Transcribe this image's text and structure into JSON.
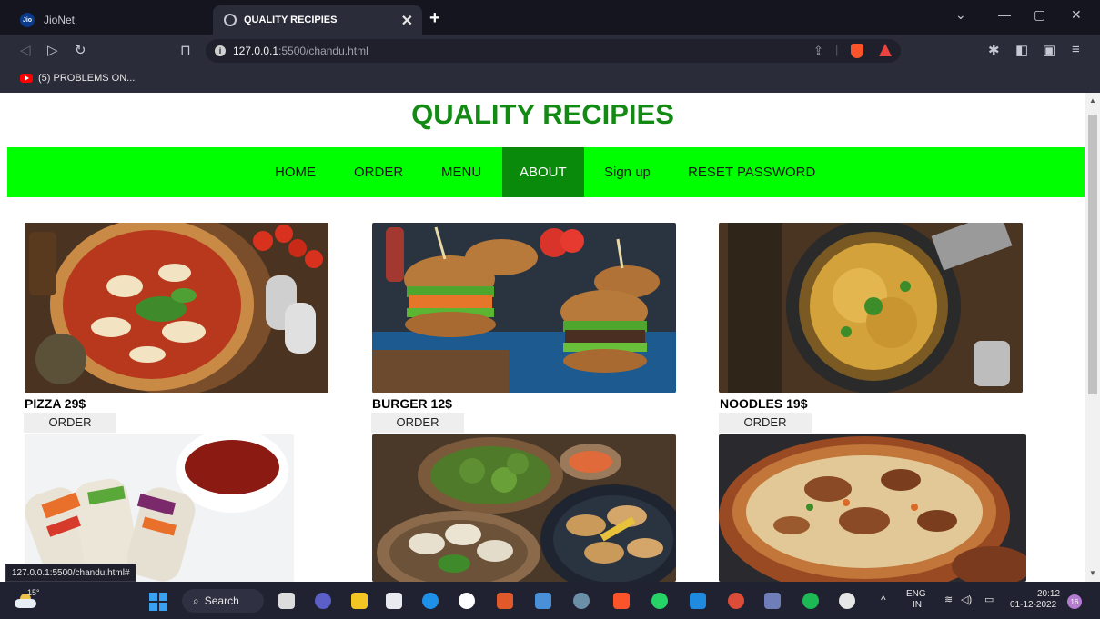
{
  "browser": {
    "tabs": [
      {
        "label": "JioNet",
        "active": false
      },
      {
        "label": "QUALITY RECIPIES",
        "active": true
      }
    ],
    "url": {
      "host": "127.0.0.1",
      "rest": ":5500/chandu.html"
    },
    "bookmark": "(5) PROBLEMS ON...",
    "status_url": "127.0.0.1:5500/chandu.html#"
  },
  "site": {
    "title": "QUALITY RECIPIES",
    "nav": [
      "HOME",
      "ORDER",
      "MENU",
      "ABOUT",
      "Sign up",
      "RESET PASSWORD"
    ],
    "active_nav": "ABOUT",
    "items": [
      {
        "label": "PIZZA 29$",
        "button": "ORDER"
      },
      {
        "label": "BURGER 12$",
        "button": "ORDER"
      },
      {
        "label": "NOODLES 19$",
        "button": "ORDER"
      }
    ]
  },
  "taskbar": {
    "weather": "15°",
    "search": "Search",
    "lang_top": "ENG",
    "lang_bottom": "IN",
    "time": "20:12",
    "date": "01-12-2022",
    "notifications": "16"
  },
  "colors": {
    "title": "#138a13",
    "navbar": "#00ff00",
    "nav_active": "#0a8a0a"
  }
}
